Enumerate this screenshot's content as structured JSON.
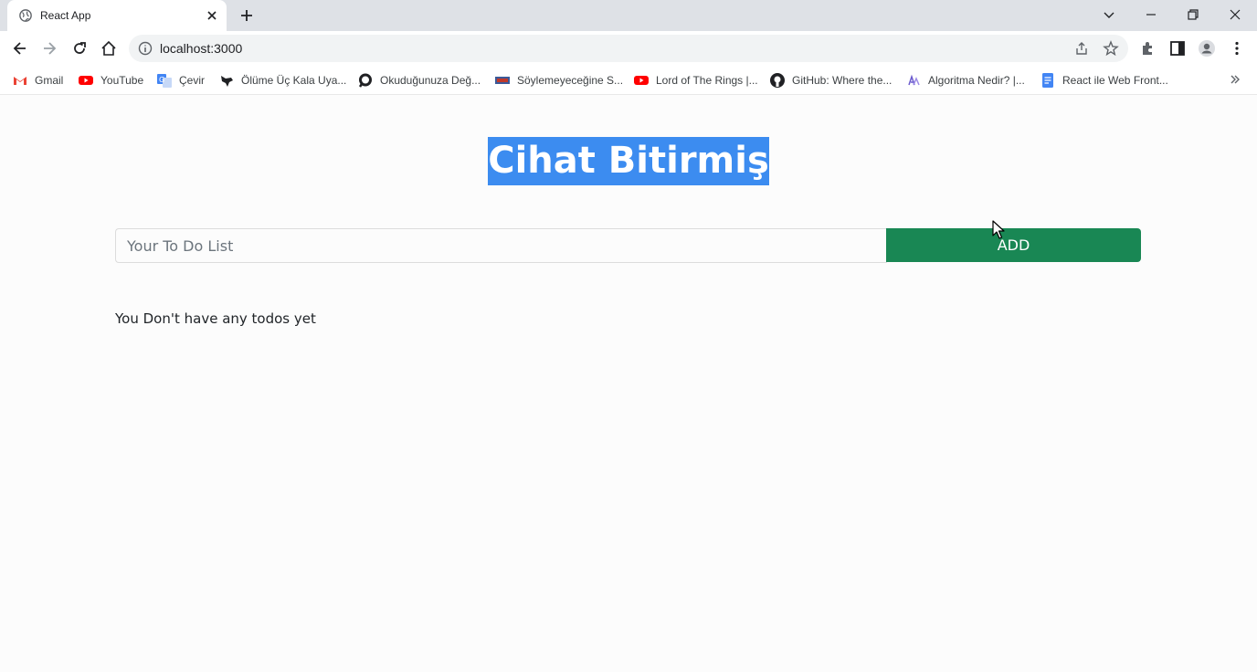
{
  "browser": {
    "tab_title": "React App",
    "url": "localhost:3000",
    "bookmarks": [
      {
        "label": "Gmail",
        "icon": "gmail-icon",
        "color": "#ea4335"
      },
      {
        "label": "YouTube",
        "icon": "youtube-icon",
        "color": "#ff0000"
      },
      {
        "label": "Çevir",
        "icon": "translate-icon",
        "color": "#4285f4"
      },
      {
        "label": "Ölüme Üç Kala Uya...",
        "icon": "crow-icon",
        "color": "#202124"
      },
      {
        "label": "Okuduğunuza Değ...",
        "icon": "o-logo-icon",
        "color": "#202124"
      },
      {
        "label": "Söylemeyeceğine S...",
        "icon": "site-icon",
        "color": "#3b5998"
      },
      {
        "label": "Lord of The Rings |...",
        "icon": "youtube-icon",
        "color": "#ff0000"
      },
      {
        "label": "GitHub: Where the...",
        "icon": "github-icon",
        "color": "#202124"
      },
      {
        "label": "Algoritma Nedir? |...",
        "icon": "site-icon",
        "color": "#6a5acd"
      },
      {
        "label": "React ile Web Front...",
        "icon": "docs-icon",
        "color": "#4285f4"
      }
    ]
  },
  "app": {
    "title": "Cihat Bitirmiş",
    "input_placeholder": "Your To Do List",
    "add_label": "ADD",
    "empty_message": "You Don't have any todos yet",
    "accent_color": "#198754",
    "selection_color": "#3c8cf0"
  }
}
